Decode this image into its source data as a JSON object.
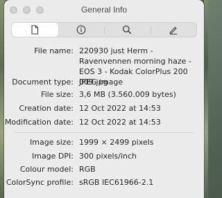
{
  "window": {
    "title": "General Info"
  },
  "tabs": [
    {
      "icon": "document-icon"
    },
    {
      "icon": "info-icon"
    },
    {
      "icon": "search-icon"
    },
    {
      "icon": "pencil-icon"
    }
  ],
  "info": {
    "file_name_label": "File name:",
    "file_name": "220930 just Herm - Ravenvennen morning haze - EOS 3 - Kodak ColorPlus 200 009.jpg",
    "document_type_label": "Document type:",
    "document_type": "JPEG image",
    "file_size_label": "File size:",
    "file_size": "3,6 MB (3.560.009 bytes)",
    "creation_date_label": "Creation date:",
    "creation_date": "12 Oct 2022 at 14:53",
    "modification_date_label": "Modification date:",
    "modification_date": "12 Oct 2022 at 14:53",
    "image_size_label": "Image size:",
    "image_size": "1999 × 2499 pixels",
    "image_dpi_label": "Image DPI:",
    "image_dpi": "300 pixels/inch",
    "colour_model_label": "Colour model:",
    "colour_model": "RGB",
    "colorsync_profile_label": "ColorSync profile:",
    "colorsync_profile": "sRGB IEC61966-2.1"
  }
}
